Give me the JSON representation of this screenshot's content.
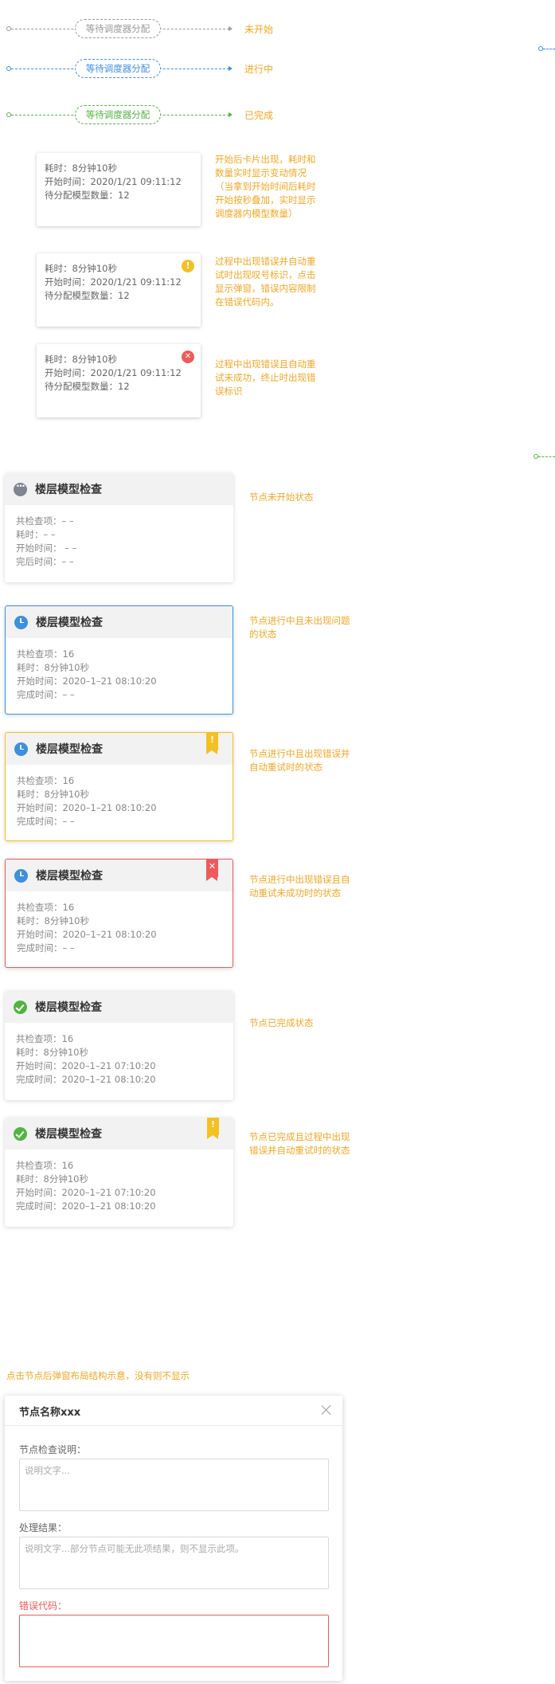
{
  "connectors": [
    {
      "pill": "等待调度器分配",
      "label": "未开始"
    },
    {
      "pill": "等待调度器分配",
      "label": "进行中"
    },
    {
      "pill": "等待调度器分配",
      "label": "已完成"
    }
  ],
  "small_cards": [
    {
      "line1": "耗时：8分钟10秒",
      "line2": "开始时间：2020/1/21 09:11:12",
      "line3": "待分配模型数量：12",
      "badge": "",
      "note": "开始后卡片出现，耗时和数量实时显示变动情况（当拿到开始时间后耗时开始按秒叠加，实时显示调度器内模型数量）"
    },
    {
      "line1": "耗时：8分钟10秒",
      "line2": "开始时间：2020/1/21 09:11:12",
      "line3": "待分配模型数量：12",
      "badge": "!",
      "note": "过程中出现错误并自动重试时出现叹号标识，点击显示弹窗，错误内容限制在错误代码内。"
    },
    {
      "line1": "耗时：8分钟10秒",
      "line2": "开始时间：2020/1/21 09:11:12",
      "line3": "待分配模型数量：12",
      "badge": "✕",
      "note": "过程中出现错误且自动重试未成功，终止时出现错误标识"
    }
  ],
  "node_cards": [
    {
      "title": "楼层模型检查",
      "lines": [
        "共检查项：– –",
        "耗时：– –",
        "开始时间： – –",
        "完后时间：– –"
      ],
      "note": "节点未开始状态"
    },
    {
      "title": "楼层模型检查",
      "lines": [
        "共检查项：16",
        "耗时：8分钟10秒",
        "开始时间：2020–1–21 08:10:20",
        "完成时间：– –"
      ],
      "note": "节点进行中且未出现问题的状态"
    },
    {
      "title": "楼层模型检查",
      "lines": [
        "共检查项：16",
        "耗时：8分钟10秒",
        "开始时间：2020–1–21 08:10:20",
        "完成时间：– –"
      ],
      "flag": "!",
      "note": "节点进行中且出现错误并自动重试时的状态"
    },
    {
      "title": "楼层模型检查",
      "lines": [
        "共检查项：16",
        "耗时：8分钟10秒",
        "开始时间：2020–1–21 08:10:20",
        "完成时间：– –"
      ],
      "flag": "✕",
      "note": "节点进行中出现错误且自动重试未成功时的状态"
    },
    {
      "title": "楼层模型检查",
      "lines": [
        "共检查项：16",
        "耗时：8分钟10秒",
        "开始时间：2020–1–21 07:10:20",
        "完成时间：2020–1–21 08:10:20"
      ],
      "note": "节点已完成状态"
    },
    {
      "title": "楼层模型检查",
      "lines": [
        "共检查项：16",
        "耗时：8分钟10秒",
        "开始时间：2020–1–21 07:10:20",
        "完成时间：2020–1–21 08:10:20"
      ],
      "flag": "!",
      "note": "节点已完成且过程中出现错误并自动重试时的状态"
    }
  ],
  "dialog": {
    "caption": "点击节点后弹窗布局结构示意，没有则不显示",
    "title": "节点名称xxx",
    "field1_label": "节点检查说明：",
    "field1_placeholder": "说明文字...",
    "field2_label": "处理结果：",
    "field2_placeholder": "说明文字...部分节点可能无此项结果，则不显示此项。",
    "field3_label": "错误代码："
  },
  "colors": {
    "gray": "#999999",
    "blue": "#3d8fe0",
    "green": "#52b541",
    "yellow": "#f5c022",
    "red": "#ee5a5a",
    "note": "#f5a623"
  }
}
